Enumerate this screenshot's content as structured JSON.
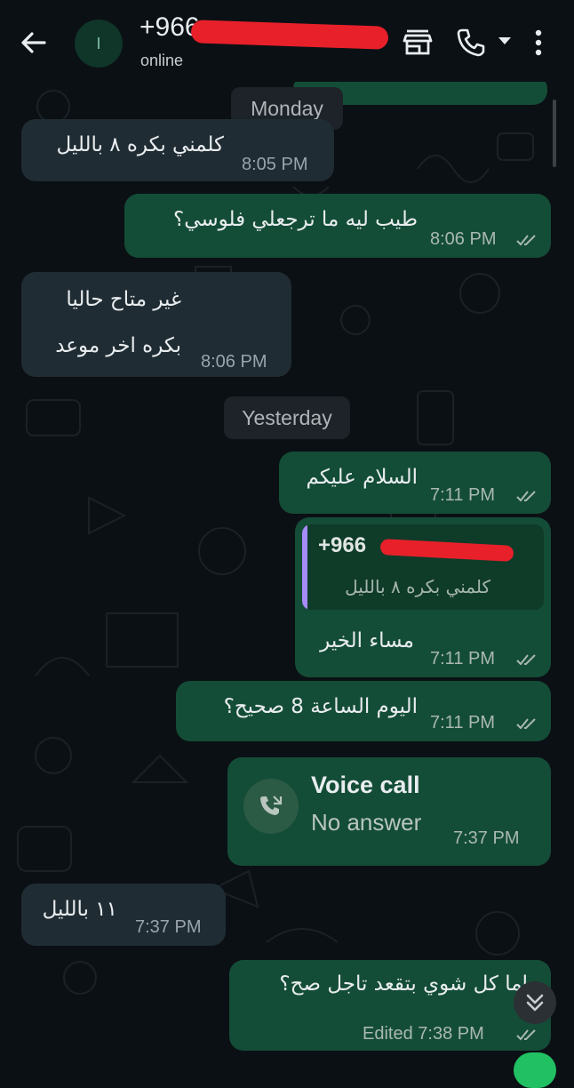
{
  "header": {
    "avatar_letter": "I",
    "contact_number": "+966",
    "status": "online"
  },
  "colors": {
    "background": "#0b1014",
    "incoming_bubble": "#202c33",
    "outgoing_bubble": "#144d37",
    "accent_green": "#21c063",
    "redaction": "#e8202a"
  },
  "icons": [
    "back-arrow-icon",
    "store-icon",
    "phone-icon",
    "chevron-down-icon",
    "more-vert-icon",
    "double-check-icon",
    "missed-call-icon",
    "scroll-down-icon"
  ],
  "dates": {
    "monday": "Monday",
    "yesterday": "Yesterday"
  },
  "messages": {
    "m1": {
      "text": "كلمني بكره ٨ بالليل",
      "time": "8:05 PM"
    },
    "m2": {
      "text": "طيب ليه ما ترجعلي فلوسي؟",
      "time": "8:06 PM"
    },
    "m3": {
      "line1": "غير متاح حاليا",
      "line2": "بكره اخر موعد",
      "time": "8:06 PM"
    },
    "m4": {
      "text": "السلام عليكم",
      "time": "7:11 PM"
    },
    "m5": {
      "quote_author": "+966",
      "quote_text": "كلمني بكره ٨ بالليل",
      "text": "مساء الخير",
      "time": "7:11 PM"
    },
    "m6": {
      "text": "اليوم الساعة 8 صحيح؟",
      "time": "7:11 PM"
    },
    "m7": {
      "title": "Voice call",
      "subtitle": "No answer",
      "time": "7:37 PM"
    },
    "m8": {
      "text": "١١ بالليل",
      "time": "7:37 PM"
    },
    "m9": {
      "text": "اما كل شوي بتقعد تاجل صح؟",
      "time": "Edited 7:38 PM"
    }
  }
}
